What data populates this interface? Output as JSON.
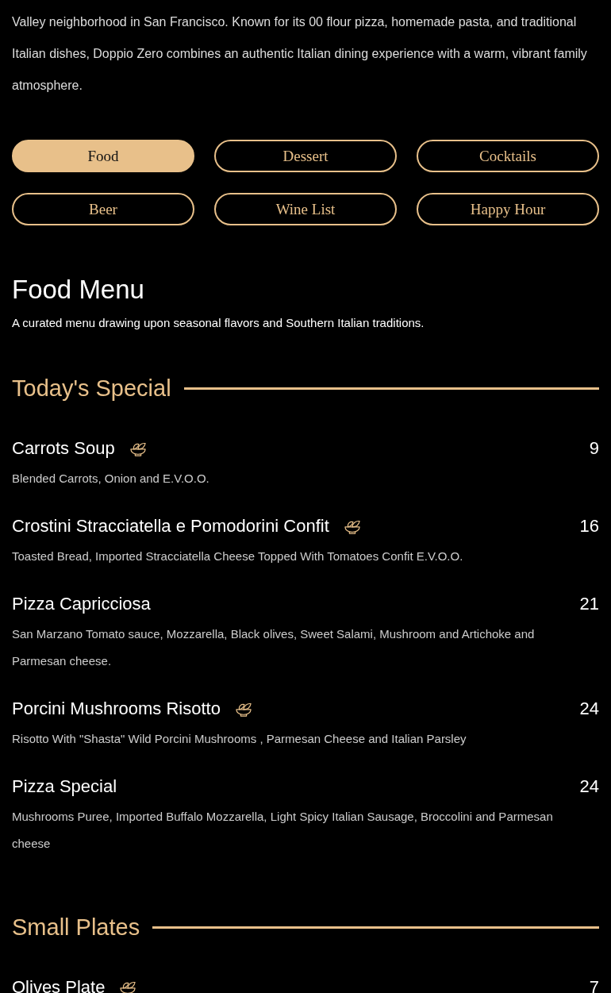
{
  "intro": "Valley neighborhood in San Francisco. Known for its 00 flour pizza, homemade pasta, and traditional Italian dishes, Doppio Zero combines an authentic Italian dining experience with a warm, vibrant family atmosphere.",
  "menu_tabs": [
    {
      "label": "Food",
      "selected": true
    },
    {
      "label": "Dessert",
      "selected": false
    },
    {
      "label": "Cocktails",
      "selected": false
    },
    {
      "label": "Beer",
      "selected": false
    },
    {
      "label": "Wine List",
      "selected": false
    },
    {
      "label": "Happy Hour",
      "selected": false
    }
  ],
  "title": "Food Menu",
  "subtitle": "A curated menu drawing upon seasonal flavors and Southern Italian traditions.",
  "sections": [
    {
      "heading": "Today's Special",
      "items": [
        {
          "name": "Carrots Soup",
          "vegetarian": true,
          "price": "9",
          "description": "Blended Carrots, Onion and E.V.O.O."
        },
        {
          "name": "Crostini Stracciatella e Pomodorini Confit",
          "vegetarian": true,
          "price": "16",
          "description": "Toasted Bread, Imported Stracciatella Cheese Topped With Tomatoes Confit E.V.O.O."
        },
        {
          "name": "Pizza Capricciosa",
          "vegetarian": false,
          "price": "21",
          "description": "San Marzano Tomato sauce, Mozzarella, Black olives, Sweet Salami, Mushroom and Artichoke and Parmesan cheese."
        },
        {
          "name": "Porcini Mushrooms Risotto",
          "vegetarian": true,
          "price": "24",
          "description": "Risotto With \"Shasta\" Wild Porcini Mushrooms , Parmesan Cheese and Italian Parsley"
        },
        {
          "name": "Pizza Special",
          "vegetarian": false,
          "price": "24",
          "description": "Mushrooms Puree, Imported Buffalo Mozzarella, Light Spicy Italian Sausage, Broccolini and Parmesan cheese"
        }
      ]
    },
    {
      "heading": "Small Plates",
      "items": [
        {
          "name": "Olives Plate",
          "vegetarian": true,
          "price": "7"
        }
      ]
    }
  ]
}
